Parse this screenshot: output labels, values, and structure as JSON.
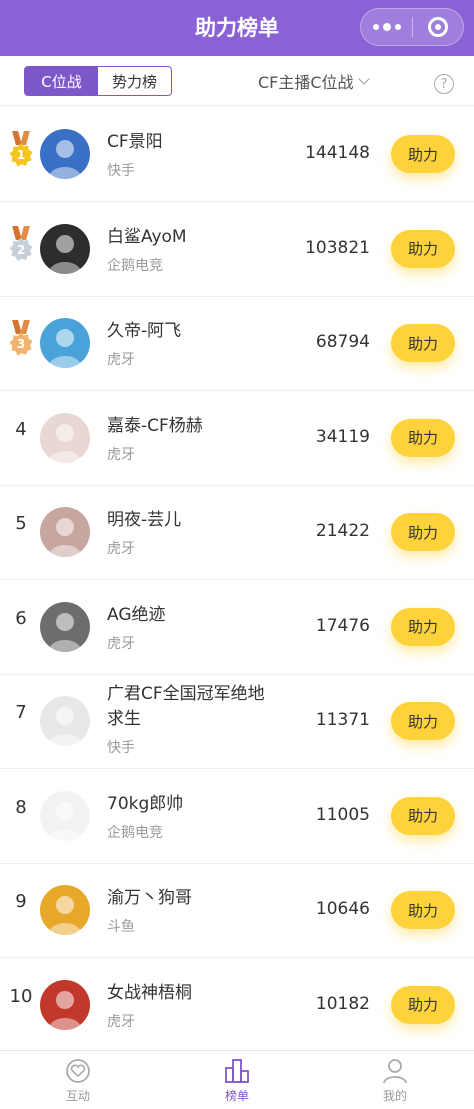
{
  "header": {
    "title": "助力榜单"
  },
  "filter": {
    "tabs": [
      {
        "label": "C位战",
        "active": true
      },
      {
        "label": "势力榜",
        "active": false
      }
    ],
    "dropdown": "CF主播C位战",
    "help": "?"
  },
  "ranking": [
    {
      "rank": "1",
      "medal": "gold",
      "name": "CF景阳",
      "platform": "快手",
      "score": "144148",
      "button": "助力",
      "avatar_color": "#3a6fc6"
    },
    {
      "rank": "2",
      "medal": "silver",
      "name": "白鲨AyoM",
      "platform": "企鹅电竞",
      "score": "103821",
      "button": "助力",
      "avatar_color": "#2d2d2d"
    },
    {
      "rank": "3",
      "medal": "bronze",
      "name": "久帝-阿飞",
      "platform": "虎牙",
      "score": "68794",
      "button": "助力",
      "avatar_color": "#4aa3d8"
    },
    {
      "rank": "4",
      "medal": "",
      "name": "嘉泰-CF杨赫",
      "platform": "虎牙",
      "score": "34119",
      "button": "助力",
      "avatar_color": "#e9d7d3"
    },
    {
      "rank": "5",
      "medal": "",
      "name": "明夜-芸儿",
      "platform": "虎牙",
      "score": "21422",
      "button": "助力",
      "avatar_color": "#c8a6a0"
    },
    {
      "rank": "6",
      "medal": "",
      "name": "AG绝迹",
      "platform": "虎牙",
      "score": "17476",
      "button": "助力",
      "avatar_color": "#6d6d6d"
    },
    {
      "rank": "7",
      "medal": "",
      "name": "广君CF全国冠军绝地求生",
      "platform": "快手",
      "score": "11371",
      "button": "助力",
      "avatar_color": "#e8e8e8"
    },
    {
      "rank": "8",
      "medal": "",
      "name": "70kg郎帅",
      "platform": "企鹅电竞",
      "score": "11005",
      "button": "助力",
      "avatar_color": "#f2f2f2"
    },
    {
      "rank": "9",
      "medal": "",
      "name": "渝万丶狗哥",
      "platform": "斗鱼",
      "score": "10646",
      "button": "助力",
      "avatar_color": "#e7a82a"
    },
    {
      "rank": "10",
      "medal": "",
      "name": "女战神梧桐",
      "platform": "虎牙",
      "score": "10182",
      "button": "助力",
      "avatar_color": "#c0392b"
    }
  ],
  "tabbar": [
    {
      "label": "互动",
      "icon": "interact-icon",
      "active": false
    },
    {
      "label": "榜单",
      "icon": "ranking-icon",
      "active": true
    },
    {
      "label": "我的",
      "icon": "user-icon",
      "active": false
    }
  ],
  "colors": {
    "brand": "#8a62d6",
    "button": "#fdd23a"
  }
}
